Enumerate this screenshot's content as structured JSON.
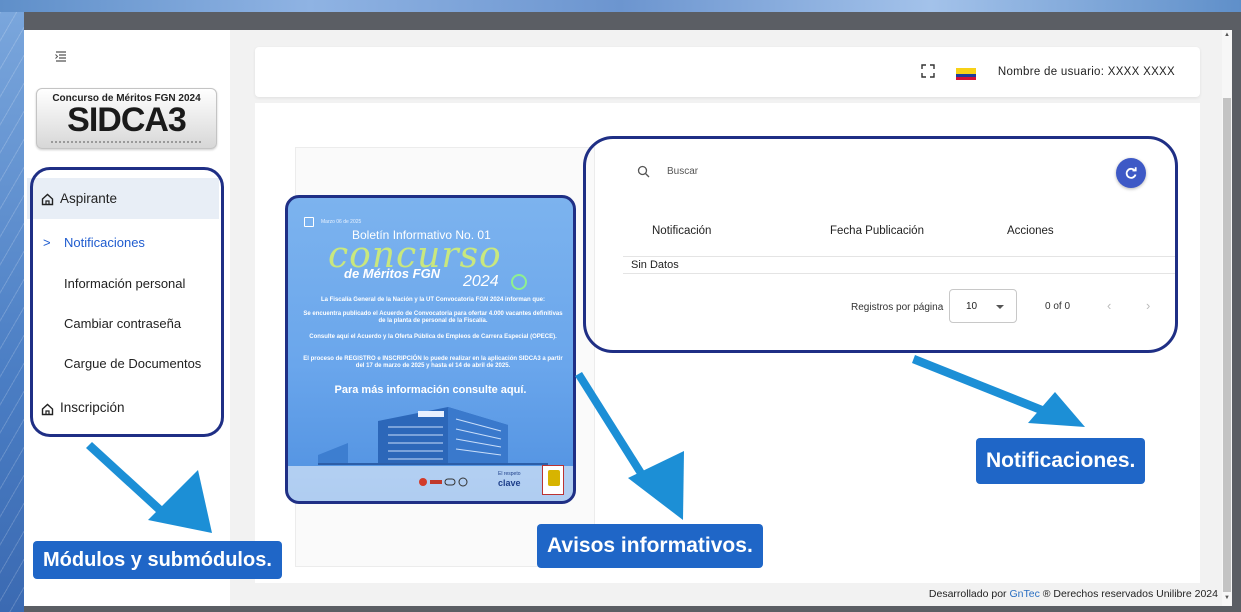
{
  "app": {
    "logo_top": "Concurso de Méritos FGN 2024",
    "logo_main": "SIDCA3"
  },
  "sidebar": {
    "items": [
      {
        "label": "Aspirante",
        "icon": "home-icon"
      },
      {
        "label": "Notificaciones",
        "prefix": ">"
      },
      {
        "label": "Información personal"
      },
      {
        "label": "Cambiar contraseña"
      },
      {
        "label": "Cargue de Documentos"
      },
      {
        "label": "Inscripción",
        "icon": "home-icon"
      }
    ]
  },
  "header": {
    "username": "Nombre de usuario: XXXX XXXX"
  },
  "notifications": {
    "search_placeholder": "Buscar",
    "columns": [
      "Notificación",
      "Fecha Publicación",
      "Acciones"
    ],
    "empty_text": "Sin Datos",
    "per_page_label": "Registros por página",
    "per_page_value": "10",
    "range_text": "0 of 0",
    "prev": "‹",
    "next": "›"
  },
  "poster": {
    "date": "Marzo 06 de 2025",
    "boletin": "Boletín Informativo No. 01",
    "concurso": "concurso",
    "meritos": "de Méritos FGN",
    "year": "2024",
    "intro": "La Fiscalía General de la Nación y la UT Convocatoria FGN 2024 informan que:",
    "p1": "Se encuentra publicado el Acuerdo de Convocatoria para ofertar 4.000 vacantes definitivas de la planta de personal de la Fiscalía.",
    "p2": "Consulte aquí el Acuerdo y la Oferta Pública de Empleos de Carrera Especial (OPECE).",
    "p3": "El proceso de REGISTRO e INSCRIPCIÓN lo puede realizar en la aplicación SIDCA3 a partir del 17 de marzo de 2025 y hasta el 14 de abril de 2025.",
    "mas": "Para más información consulte aquí.",
    "clave_small": "El respeto",
    "clave": "clave"
  },
  "footer": {
    "prefix": "Desarrollado por ",
    "link": "GnTec",
    "suffix": " ® Derechos reservados Unilibre 2024"
  },
  "annotations": {
    "modules": "Módulos y submódulos.",
    "avisos": "Avisos informativos.",
    "notificaciones": "Notificaciones."
  },
  "colors": {
    "annotation_box": "#1f66c7",
    "highlight_border": "#1f2f85",
    "refresh_button": "#3e59c6",
    "arrow": "#1c8fd6"
  }
}
